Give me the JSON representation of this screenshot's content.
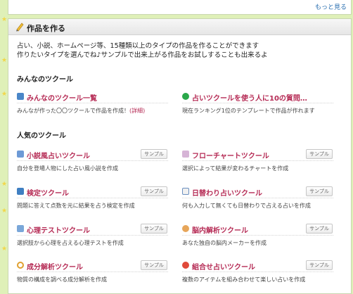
{
  "top": {
    "more_label": "もっと見る"
  },
  "panel": {
    "title": "作品を作る",
    "intro_line1": "占い、小説、ホームページ等、15種類以上のタイプの作品を作ることができます",
    "intro_line2": "作りたいタイプを選んでね♪サンプルで出来上がる作品をお試しすることも出来るよ"
  },
  "sections": {
    "everyone": "みんなのツクール",
    "popular": "人気のツクール"
  },
  "everyone_tools": [
    {
      "name": "みんなのツクール一覧",
      "desc": "みんなが作った〇〇ツクールで作品を作成！",
      "detail": "(詳細)",
      "icon": "users-icon"
    },
    {
      "name": "占いツクールを使う人に10の質問…",
      "desc": "現在ランキング1位のテンプレートで作品が作れます",
      "icon": "bullet-icon"
    }
  ],
  "popular_tools": [
    {
      "name": "小説風占いツクール",
      "desc": "自分を登場人物にした占い風小説を作成",
      "sample": "サンプル",
      "icon": "book-icon"
    },
    {
      "name": "フローチャートツクール",
      "desc": "選択によって結果が変わるチャートを作成",
      "sample": "サンプル",
      "icon": "flowchart-icon"
    },
    {
      "name": "検定ツクール",
      "desc": "問題に答えて点数を元に結果を占う検定を作成",
      "sample": "サンプル",
      "icon": "quiz-icon"
    },
    {
      "name": "日替わり占いツクール",
      "desc": "何も入力して無くても日替わりで占える占いを作成",
      "sample": "サンプル",
      "icon": "calendar-icon"
    },
    {
      "name": "心理テストツクール",
      "desc": "選択肢から心理を占える心理テストを作成",
      "sample": "サンプル",
      "icon": "psych-icon"
    },
    {
      "name": "脳内解析ツクール",
      "desc": "あなた独自の脳内メーカーを作成",
      "sample": "サンプル",
      "icon": "brain-icon"
    },
    {
      "name": "成分解析ツクール",
      "desc": "物質の構成を調べる成分解析を作成",
      "sample": "サンプル",
      "icon": "magnifier-icon"
    },
    {
      "name": "組合せ占いツクール",
      "desc": "複数のアイテムを組み合わせて楽しい占いを作成",
      "sample": "サンプル",
      "icon": "combo-icon"
    }
  ],
  "colors": {
    "accent": "#b52a54",
    "background": "#dff0b8",
    "star": "#f2d64a"
  }
}
